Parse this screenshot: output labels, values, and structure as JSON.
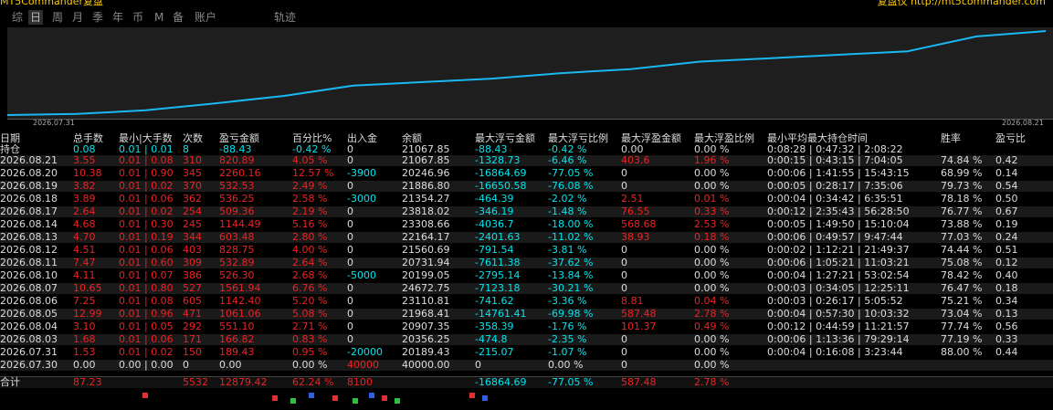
{
  "window": {
    "title_left": "MT5Commander复盘",
    "title_right": "复盘仪 http://mt5commander.com"
  },
  "tabs": [
    {
      "label": "综",
      "active": false
    },
    {
      "label": "日",
      "active": true
    },
    {
      "label": "周",
      "active": false
    },
    {
      "label": "月",
      "active": false
    },
    {
      "label": "季",
      "active": false
    },
    {
      "label": "年",
      "active": false
    },
    {
      "label": "币",
      "active": false
    },
    {
      "label": "M",
      "active": false
    },
    {
      "label": "备",
      "active": false
    },
    {
      "label": "账户",
      "active": false
    },
    {
      "label": "轨迹",
      "active": false
    }
  ],
  "chart": {
    "start_label": "2026.07.31",
    "end_label": "2026.08.21",
    "line_color": "#1ab8f0"
  },
  "headers": {
    "date": "日期",
    "holding": "持仓",
    "total_lots": "总手数",
    "min_max_lots": "最小|大手数",
    "count": "次数",
    "pnl": "盈亏金额",
    "pct": "百分比%",
    "in_out": "出入金",
    "balance": "余额",
    "max_float_loss": "最大浮亏金额",
    "max_float_loss_pct": "最大浮亏比例",
    "max_float_profit": "最大浮盈金额",
    "max_float_profit_pct": "最大浮盈比例",
    "hold_time": "最小平均最大持仓时间",
    "win_rate": "胜率",
    "pl_ratio": "盈亏比"
  },
  "holding_row": {
    "total_lots": "0.08",
    "min_max": "0.01 | 0.01",
    "count": "8",
    "pnl": "-88.43",
    "pct": "-0.42 %",
    "in_out": "0",
    "balance": "21067.85",
    "max_float_loss": "-88.43",
    "max_float_loss_pct": "-0.42 %",
    "max_float_profit": "0.00",
    "max_float_profit_pct": "0.00 %",
    "hold_time": "0:08:28 | 0:47:32 | 2:08:22"
  },
  "rows": [
    {
      "date": "2026.08.21",
      "total_lots": "3.55",
      "min_max": "0.01 | 0.08",
      "count": "310",
      "pnl": "820.89",
      "pct": "4.05 %",
      "in_out": "0",
      "balance": "21067.85",
      "mfl": "-1328.73",
      "mflp": "-6.46 %",
      "mfp": "403.6",
      "mfpp": "1.96 %",
      "hold": "0:00:15 | 0:43:15 | 7:04:05",
      "win": "74.84 %",
      "plr": "0.42"
    },
    {
      "date": "2026.08.20",
      "total_lots": "10.38",
      "min_max": "0.01 | 0.90",
      "count": "345",
      "pnl": "2260.16",
      "pct": "12.57 %",
      "in_out": "-3900",
      "balance": "20246.96",
      "mfl": "-16864.69",
      "mflp": "-77.05 %",
      "mfp": "0",
      "mfpp": "0.00 %",
      "hold": "0:00:06 | 1:41:55 | 15:43:15",
      "win": "68.99 %",
      "plr": "0.14"
    },
    {
      "date": "2026.08.19",
      "total_lots": "3.82",
      "min_max": "0.01 | 0.02",
      "count": "370",
      "pnl": "532.53",
      "pct": "2.49 %",
      "in_out": "0",
      "balance": "21886.80",
      "mfl": "-16650.58",
      "mflp": "-76.08 %",
      "mfp": "0",
      "mfpp": "0.00 %",
      "hold": "0:00:05 | 0:28:17 | 7:35:06",
      "win": "79.73 %",
      "plr": "0.54"
    },
    {
      "date": "2026.08.18",
      "total_lots": "3.89",
      "min_max": "0.01 | 0.06",
      "count": "362",
      "pnl": "536.25",
      "pct": "2.58 %",
      "in_out": "-3000",
      "balance": "21354.27",
      "mfl": "-464.39",
      "mflp": "-2.02 %",
      "mfp": "2.51",
      "mfpp": "0.01 %",
      "hold": "0:00:04 | 0:34:42 | 6:35:51",
      "win": "78.18 %",
      "plr": "0.50"
    },
    {
      "date": "2026.08.17",
      "total_lots": "2.64",
      "min_max": "0.01 | 0.02",
      "count": "254",
      "pnl": "509.36",
      "pct": "2.19 %",
      "in_out": "0",
      "balance": "23818.02",
      "mfl": "-346.19",
      "mflp": "-1.48 %",
      "mfp": "76.55",
      "mfpp": "0.33 %",
      "hold": "0:00:12 | 2:35:43 | 56:28:50",
      "win": "76.77 %",
      "plr": "0.67"
    },
    {
      "date": "2026.08.14",
      "total_lots": "4.68",
      "min_max": "0.01 | 0.30",
      "count": "245",
      "pnl": "1144.49",
      "pct": "5.16 %",
      "in_out": "0",
      "balance": "23308.66",
      "mfl": "-4036.7",
      "mflp": "-18.00 %",
      "mfp": "568.68",
      "mfpp": "2.53 %",
      "hold": "0:00:05 | 1:49:50 | 15:10:04",
      "win": "73.88 %",
      "plr": "0.19"
    },
    {
      "date": "2026.08.13",
      "total_lots": "4.70",
      "min_max": "0.01 | 0.19",
      "count": "344",
      "pnl": "603.48",
      "pct": "2.80 %",
      "in_out": "0",
      "balance": "22164.17",
      "mfl": "-2401.63",
      "mflp": "-11.02 %",
      "mfp": "38.93",
      "mfpp": "0.18 %",
      "hold": "0:00:06 | 0:49:57 | 9:47:44",
      "win": "77.03 %",
      "plr": "0.24"
    },
    {
      "date": "2026.08.12",
      "total_lots": "4.51",
      "min_max": "0.01 | 0.06",
      "count": "403",
      "pnl": "828.75",
      "pct": "4.00 %",
      "in_out": "0",
      "balance": "21560.69",
      "mfl": "-791.54",
      "mflp": "-3.81 %",
      "mfp": "0",
      "mfpp": "0.00 %",
      "hold": "0:00:02 | 1:12:21 | 21:49:37",
      "win": "74.44 %",
      "plr": "0.51"
    },
    {
      "date": "2026.08.11",
      "total_lots": "7.47",
      "min_max": "0.01 | 0.60",
      "count": "309",
      "pnl": "532.89",
      "pct": "2.64 %",
      "in_out": "0",
      "balance": "20731.94",
      "mfl": "-7611.38",
      "mflp": "-37.62 %",
      "mfp": "0",
      "mfpp": "0.00 %",
      "hold": "0:00:06 | 1:05:21 | 11:03:21",
      "win": "75.08 %",
      "plr": "0.12"
    },
    {
      "date": "2026.08.10",
      "total_lots": "4.11",
      "min_max": "0.01 | 0.07",
      "count": "386",
      "pnl": "526.30",
      "pct": "2.68 %",
      "in_out": "-5000",
      "balance": "20199.05",
      "mfl": "-2795.14",
      "mflp": "-13.84 %",
      "mfp": "0",
      "mfpp": "0.00 %",
      "hold": "0:00:04 | 1:27:21 | 53:02:54",
      "win": "78.42 %",
      "plr": "0.40"
    },
    {
      "date": "2026.08.07",
      "total_lots": "10.65",
      "min_max": "0.01 | 0.80",
      "count": "527",
      "pnl": "1561.94",
      "pct": "6.76 %",
      "in_out": "0",
      "balance": "24672.75",
      "mfl": "-7123.18",
      "mflp": "-30.21 %",
      "mfp": "0",
      "mfpp": "0.00 %",
      "hold": "0:00:03 | 0:34:05 | 12:25:11",
      "win": "76.47 %",
      "plr": "0.18"
    },
    {
      "date": "2026.08.06",
      "total_lots": "7.25",
      "min_max": "0.01 | 0.08",
      "count": "605",
      "pnl": "1142.40",
      "pct": "5.20 %",
      "in_out": "0",
      "balance": "23110.81",
      "mfl": "-741.62",
      "mflp": "-3.36 %",
      "mfp": "8.81",
      "mfpp": "0.04 %",
      "hold": "0:00:03 | 0:26:17 | 5:05:52",
      "win": "75.21 %",
      "plr": "0.34"
    },
    {
      "date": "2026.08.05",
      "total_lots": "12.99",
      "min_max": "0.01 | 0.96",
      "count": "471",
      "pnl": "1061.06",
      "pct": "5.08 %",
      "in_out": "0",
      "balance": "21968.41",
      "mfl": "-14761.41",
      "mflp": "-69.98 %",
      "mfp": "587.48",
      "mfpp": "2.78 %",
      "hold": "0:00:04 | 0:57:30 | 10:03:32",
      "win": "73.04 %",
      "plr": "0.13"
    },
    {
      "date": "2026.08.04",
      "total_lots": "3.10",
      "min_max": "0.01 | 0.05",
      "count": "292",
      "pnl": "551.10",
      "pct": "2.71 %",
      "in_out": "0",
      "balance": "20907.35",
      "mfl": "-358.39",
      "mflp": "-1.76 %",
      "mfp": "101.37",
      "mfpp": "0.49 %",
      "hold": "0:00:12 | 0:44:59 | 11:21:57",
      "win": "77.74 %",
      "plr": "0.56"
    },
    {
      "date": "2026.08.03",
      "total_lots": "1.68",
      "min_max": "0.01 | 0.06",
      "count": "171",
      "pnl": "166.82",
      "pct": "0.83 %",
      "in_out": "0",
      "balance": "20356.25",
      "mfl": "-474.8",
      "mflp": "-2.35 %",
      "mfp": "0",
      "mfpp": "0.00 %",
      "hold": "0:00:06 | 1:13:36 | 79:29:14",
      "win": "77.19 %",
      "plr": "0.33"
    },
    {
      "date": "2026.07.31",
      "total_lots": "1.53",
      "min_max": "0.01 | 0.02",
      "count": "150",
      "pnl": "189.43",
      "pct": "0.95 %",
      "in_out": "-20000",
      "balance": "20189.43",
      "mfl": "-215.07",
      "mflp": "-1.07 %",
      "mfp": "0",
      "mfpp": "0.00 %",
      "hold": "0:00:04 | 0:16:08 | 3:23:44",
      "win": "88.00 %",
      "plr": "0.44"
    },
    {
      "date": "2026.07.30",
      "total_lots": "0.00",
      "min_max": "0.00 | 0.00",
      "count": "0",
      "pnl": "0.00",
      "pct": "0.00 %",
      "in_out": "40000",
      "balance": "40000.00",
      "mfl": "0",
      "mflp": "0.00 %",
      "mfp": "0",
      "mfpp": "0.00 %",
      "hold": "",
      "win": "",
      "plr": ""
    }
  ],
  "total_row": {
    "label": "合计",
    "total_lots": "87.23",
    "count": "5532",
    "pnl": "12879.42",
    "pct": "62.24 %",
    "in_out": "8100",
    "max_float_loss": "-16864.69",
    "max_float_loss_pct": "-77.05 %",
    "max_float_profit": "587.48",
    "max_float_profit_pct": "2.78 %"
  },
  "equity_curve": [
    20189.43,
    20356.25,
    20907.35,
    21968.41,
    23110.81,
    24672.75,
    25199.05,
    25731.94,
    26560.69,
    27164.17,
    28308.66,
    28818.02,
    29354.27,
    29886.8,
    32146.96,
    32967.85
  ]
}
